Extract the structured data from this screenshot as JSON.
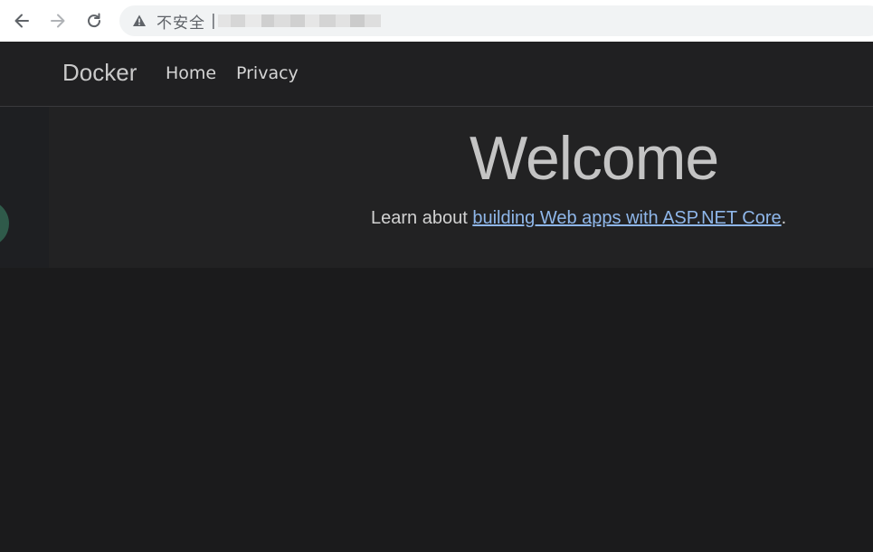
{
  "browser": {
    "security_label": "不安全",
    "url_separator": "|",
    "icons": {
      "back": "arrow-left-icon",
      "forward": "arrow-right-icon",
      "reload": "reload-icon",
      "security": "warning-triangle-icon"
    }
  },
  "navbar": {
    "brand": "Docker",
    "links": [
      {
        "label": "Home"
      },
      {
        "label": "Privacy"
      }
    ]
  },
  "hero": {
    "title": "Welcome",
    "learn_prefix": "Learn about ",
    "learn_link_text": "building Web apps with ASP.NET Core",
    "learn_suffix": "."
  },
  "colors": {
    "page_background": "#1b1b1c",
    "navbar_background": "#202022",
    "hero_background": "#222223",
    "link": "#8fb7ea",
    "floating_button": "#2f5a4a"
  }
}
